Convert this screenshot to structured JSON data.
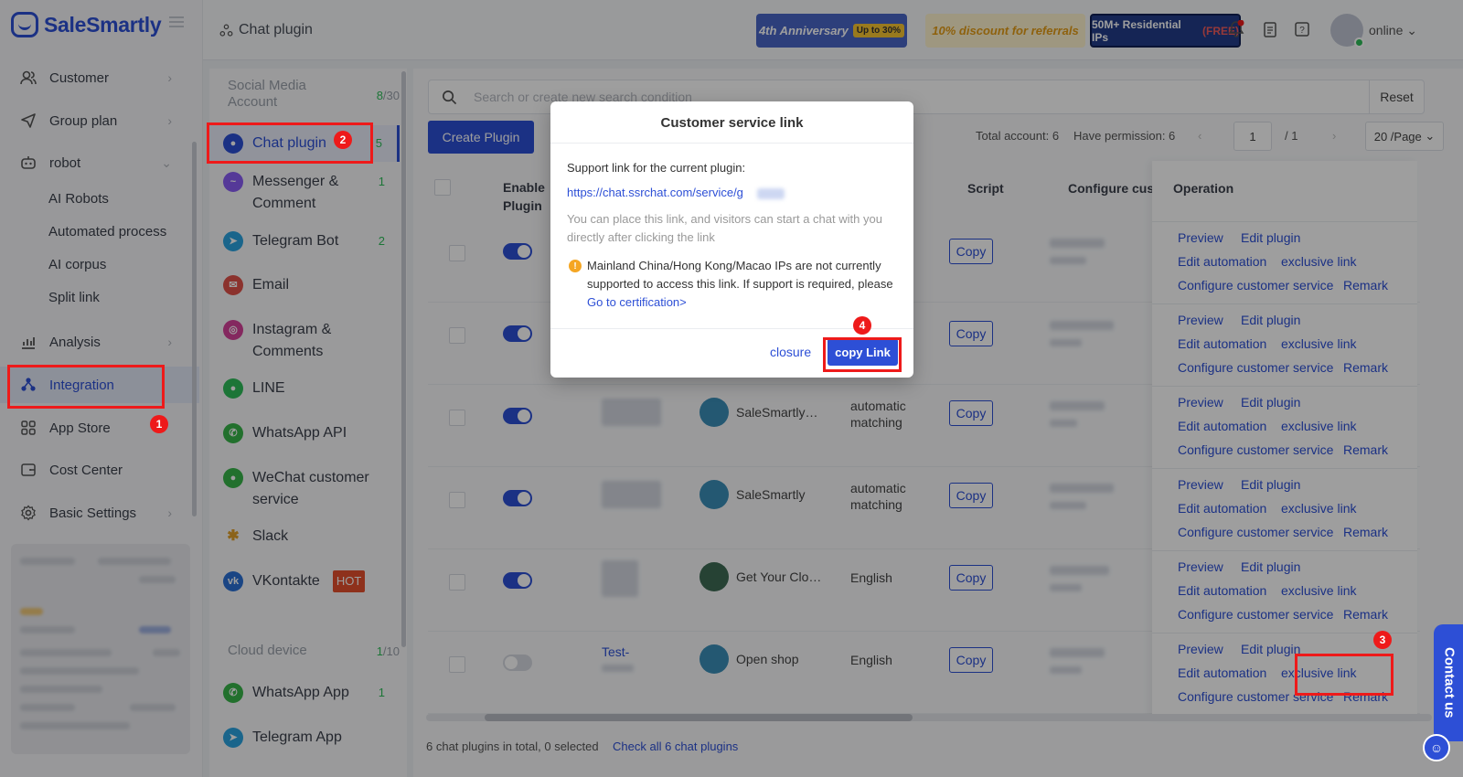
{
  "app": {
    "logo_text": "SaleSmartly",
    "brand_color": "#2d4fd6"
  },
  "sidebar": {
    "items": [
      {
        "label": "Customer",
        "icon": "customer-icon"
      },
      {
        "label": "Group plan",
        "icon": "send-icon"
      },
      {
        "label": "robot",
        "icon": "robot-icon"
      },
      {
        "label": "Analysis",
        "icon": "chart-icon"
      },
      {
        "label": "Integration",
        "icon": "integration-icon"
      },
      {
        "label": "App Store",
        "icon": "grid-icon"
      },
      {
        "label": "Cost Center",
        "icon": "wallet-icon"
      },
      {
        "label": "Basic Settings",
        "icon": "gear-icon"
      }
    ],
    "sub_items": [
      "AI Robots",
      "Automated process",
      "AI corpus",
      "Split link"
    ]
  },
  "topbar": {
    "breadcrumb": "Chat plugin",
    "banner1_text": "4th Anniversary",
    "banner1_badge": "Up to 30%",
    "banner2_text": "10% discount for referrals",
    "banner3_text": "50M+ Residential IPs",
    "banner3_badge": "(FREE)",
    "status": "online"
  },
  "channels": {
    "social_heading": "Social Media Account",
    "social_count": "8",
    "social_total": "/30",
    "items": [
      {
        "label": "Chat plugin",
        "count": "5"
      },
      {
        "label": "Messenger & Comment",
        "count": "1"
      },
      {
        "label": "Telegram Bot",
        "count": "2"
      },
      {
        "label": "Email",
        "count": ""
      },
      {
        "label": "Instagram & Comments",
        "count": ""
      },
      {
        "label": "LINE",
        "count": ""
      },
      {
        "label": "WhatsApp API",
        "count": ""
      },
      {
        "label": "WeChat customer service",
        "count": ""
      },
      {
        "label": "Slack",
        "count": ""
      },
      {
        "label": "VKontakte",
        "count": ""
      }
    ],
    "hot_label": "HOT",
    "cloud_heading": "Cloud device",
    "cloud_count": "1",
    "cloud_total": "/10",
    "cloud_items": [
      {
        "label": "WhatsApp App",
        "count": "1"
      },
      {
        "label": "Telegram App",
        "count": ""
      }
    ]
  },
  "main": {
    "search_placeholder": "Search or create new search condition",
    "reset_label": "Reset",
    "create_label": "Create Plugin",
    "total_account": "Total account: 6",
    "have_permission": "Have permission: 6",
    "page_current": "1",
    "page_total": "/ 1",
    "page_size": "20 /Page",
    "columns": {
      "enable": "Enable Plugin",
      "language": "ge",
      "script": "Script",
      "configure": "Configure custome",
      "operation": "Operation"
    },
    "copy_label": "Copy",
    "rows": [
      {
        "name": "",
        "lang": ""
      },
      {
        "name": "",
        "lang": ""
      },
      {
        "name": "SaleSmartly…",
        "lang": "automatic matching"
      },
      {
        "name": "SaleSmartly",
        "lang": "automatic matching"
      },
      {
        "name": "Get Your Clot…",
        "lang": "English"
      },
      {
        "name": "Open shop",
        "lang": "English",
        "plugin": "Test-"
      }
    ],
    "ops": {
      "preview": "Preview",
      "edit_plugin": "Edit plugin",
      "edit_automation": "Edit automation",
      "exclusive_link": "exclusive link",
      "configure_cs": "Configure customer service",
      "remark": "Remark"
    },
    "footer_total": "6 chat plugins in total, 0 selected",
    "footer_link": "Check all 6 chat plugins"
  },
  "modal": {
    "title": "Customer service link",
    "support_label": "Support link for the current plugin:",
    "link": "https://chat.ssrchat.com/service/g",
    "hint": "You can place this link, and visitors can start a chat with you directly after clicking the link",
    "warning": "Mainland China/Hong Kong/Macao IPs are not currently supported to access this link. If support is required, please",
    "cert_link": "Go to certification>",
    "closure": "closure",
    "copy_link": "copy Link"
  },
  "annotations": [
    "1",
    "2",
    "3",
    "4"
  ],
  "contact": "Contact us"
}
